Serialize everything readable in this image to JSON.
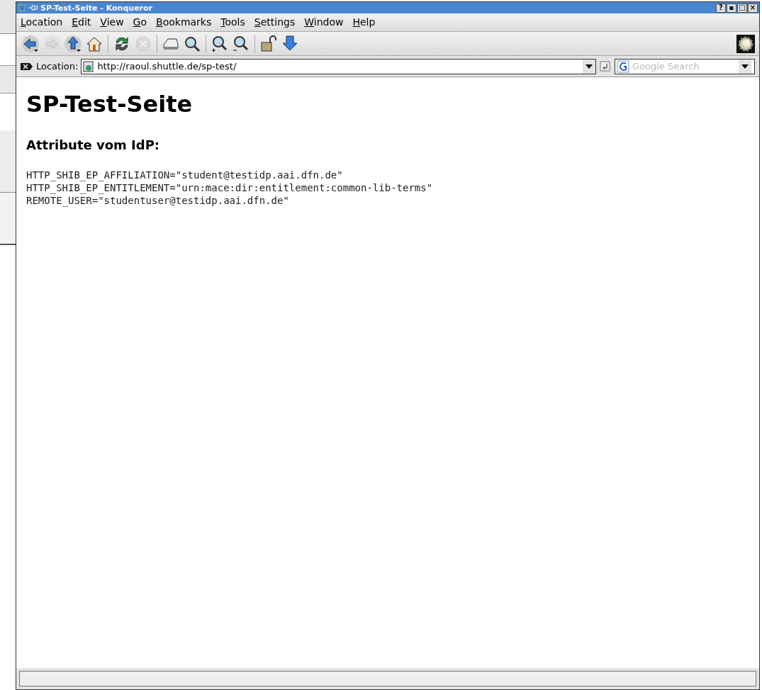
{
  "window": {
    "title": "SP-Test-Seite - Konqueror"
  },
  "title_buttons": [
    "?",
    "▪",
    "□",
    "×"
  ],
  "menu": [
    {
      "label": "Location"
    },
    {
      "label": "Edit"
    },
    {
      "label": "View"
    },
    {
      "label": "Go"
    },
    {
      "label": "Bookmarks"
    },
    {
      "label": "Tools"
    },
    {
      "label": "Settings"
    },
    {
      "label": "Window"
    },
    {
      "label": "Help"
    }
  ],
  "toolbar": [
    {
      "kind": "back",
      "disabled": false
    },
    {
      "kind": "forward",
      "disabled": true
    },
    {
      "kind": "up",
      "disabled": false
    },
    {
      "kind": "home",
      "disabled": false
    },
    {
      "kind": "sep"
    },
    {
      "kind": "reload",
      "disabled": false
    },
    {
      "kind": "stop",
      "disabled": true
    },
    {
      "kind": "sep"
    },
    {
      "kind": "print",
      "disabled": false
    },
    {
      "kind": "find",
      "disabled": false
    },
    {
      "kind": "sep"
    },
    {
      "kind": "zoomin",
      "disabled": false
    },
    {
      "kind": "zoomout",
      "disabled": false
    },
    {
      "kind": "sep"
    },
    {
      "kind": "lock",
      "disabled": false
    },
    {
      "kind": "download",
      "disabled": false
    }
  ],
  "location": {
    "label": "Location:",
    "value": "http://raoul.shuttle.de/sp-test/"
  },
  "search": {
    "placeholder": "Google Search"
  },
  "page": {
    "heading": "SP-Test-Seite",
    "subheading": "Attribute vom IdP:",
    "lines": [
      "HTTP_SHIB_EP_AFFILIATION=\"student@testidp.aai.dfn.de\"",
      "HTTP_SHIB_EP_ENTITLEMENT=\"urn:mace:dir:entitlement:common-lib-terms\"",
      "REMOTE_USER=\"studentuser@testidp.aai.dfn.de\""
    ]
  }
}
